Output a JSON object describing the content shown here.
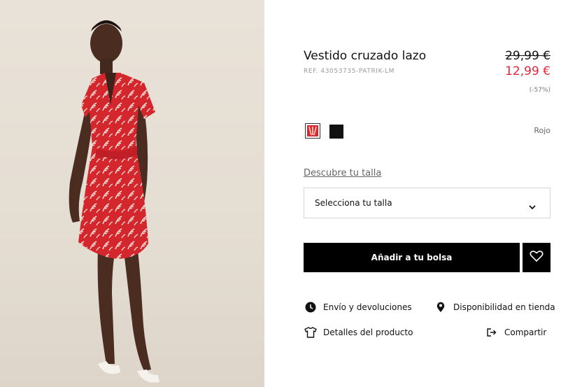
{
  "product": {
    "title": "Vestido cruzado lazo",
    "ref": "REF. 43053735-PATRIK-LM",
    "price_old": "29,99 €",
    "price_new": "12,99 €",
    "discount": "(-57%)",
    "selected_color": "Rojo"
  },
  "size": {
    "guide_link": "Descubre tu talla",
    "select_placeholder": "Selecciona tu talla"
  },
  "actions": {
    "add_to_bag": "Añadir a tu bolsa",
    "shipping": "Envío y devoluciones",
    "availability": "Disponibilidad en tienda",
    "details": "Detalles del producto",
    "share": "Compartir"
  },
  "colors": {
    "accent_red": "#e6263a",
    "swatch_red": "#d92a30",
    "swatch_black": "#111111"
  },
  "icons": {
    "shipping": "clock-icon",
    "availability": "location-pin-icon",
    "details": "tshirt-icon",
    "share": "share-icon",
    "favorite": "heart-icon",
    "dropdown": "chevron-down-icon"
  }
}
